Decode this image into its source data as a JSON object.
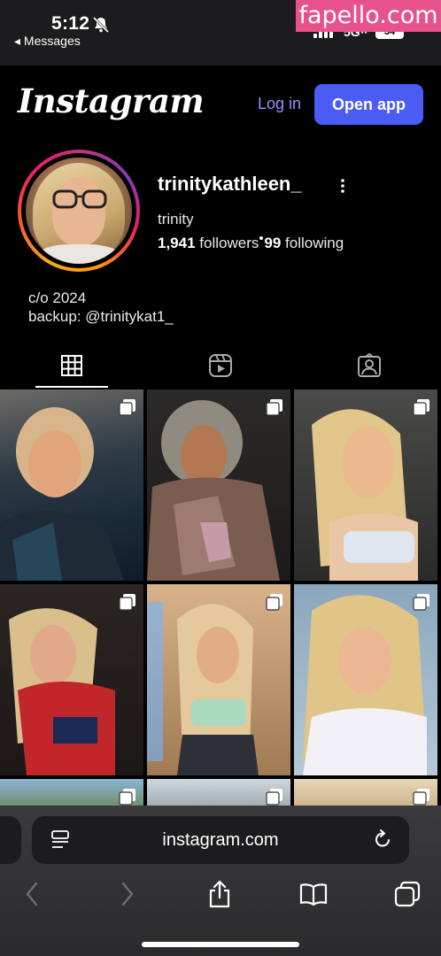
{
  "status_bar": {
    "time": "5:12",
    "back_label": "◂ Messages",
    "network": "5Gᵂ",
    "battery": "34",
    "watermark": "fapello.com"
  },
  "header": {
    "logo": "Instagram",
    "login_label": "Log in",
    "open_app_label": "Open app"
  },
  "profile": {
    "username": "trinitykathleen_",
    "full_name": "trinity",
    "followers_count": "1,941",
    "followers_label": "followers",
    "following_count": "99",
    "following_label": "following",
    "bio_line1": "c/o 2024",
    "bio_line2": "backup: @trinitykat1_"
  },
  "tabs": [
    {
      "icon": "grid-icon",
      "active": true
    },
    {
      "icon": "reels-icon",
      "active": false
    },
    {
      "icon": "tagged-icon",
      "active": false
    }
  ],
  "posts": [
    {
      "icon": "carousel-icon"
    },
    {
      "icon": "carousel-icon"
    },
    {
      "icon": "carousel-icon"
    },
    {
      "icon": "carousel-icon"
    },
    {
      "icon": "carousel-icon"
    },
    {
      "icon": "carousel-icon"
    },
    {
      "icon": "carousel-icon"
    },
    {
      "icon": "carousel-icon"
    },
    {
      "icon": "carousel-icon"
    }
  ],
  "browser": {
    "url": "instagram.com"
  },
  "colors": {
    "accent": "#4b5cf5",
    "link": "#8e95ff",
    "watermark": "#e8528a"
  }
}
